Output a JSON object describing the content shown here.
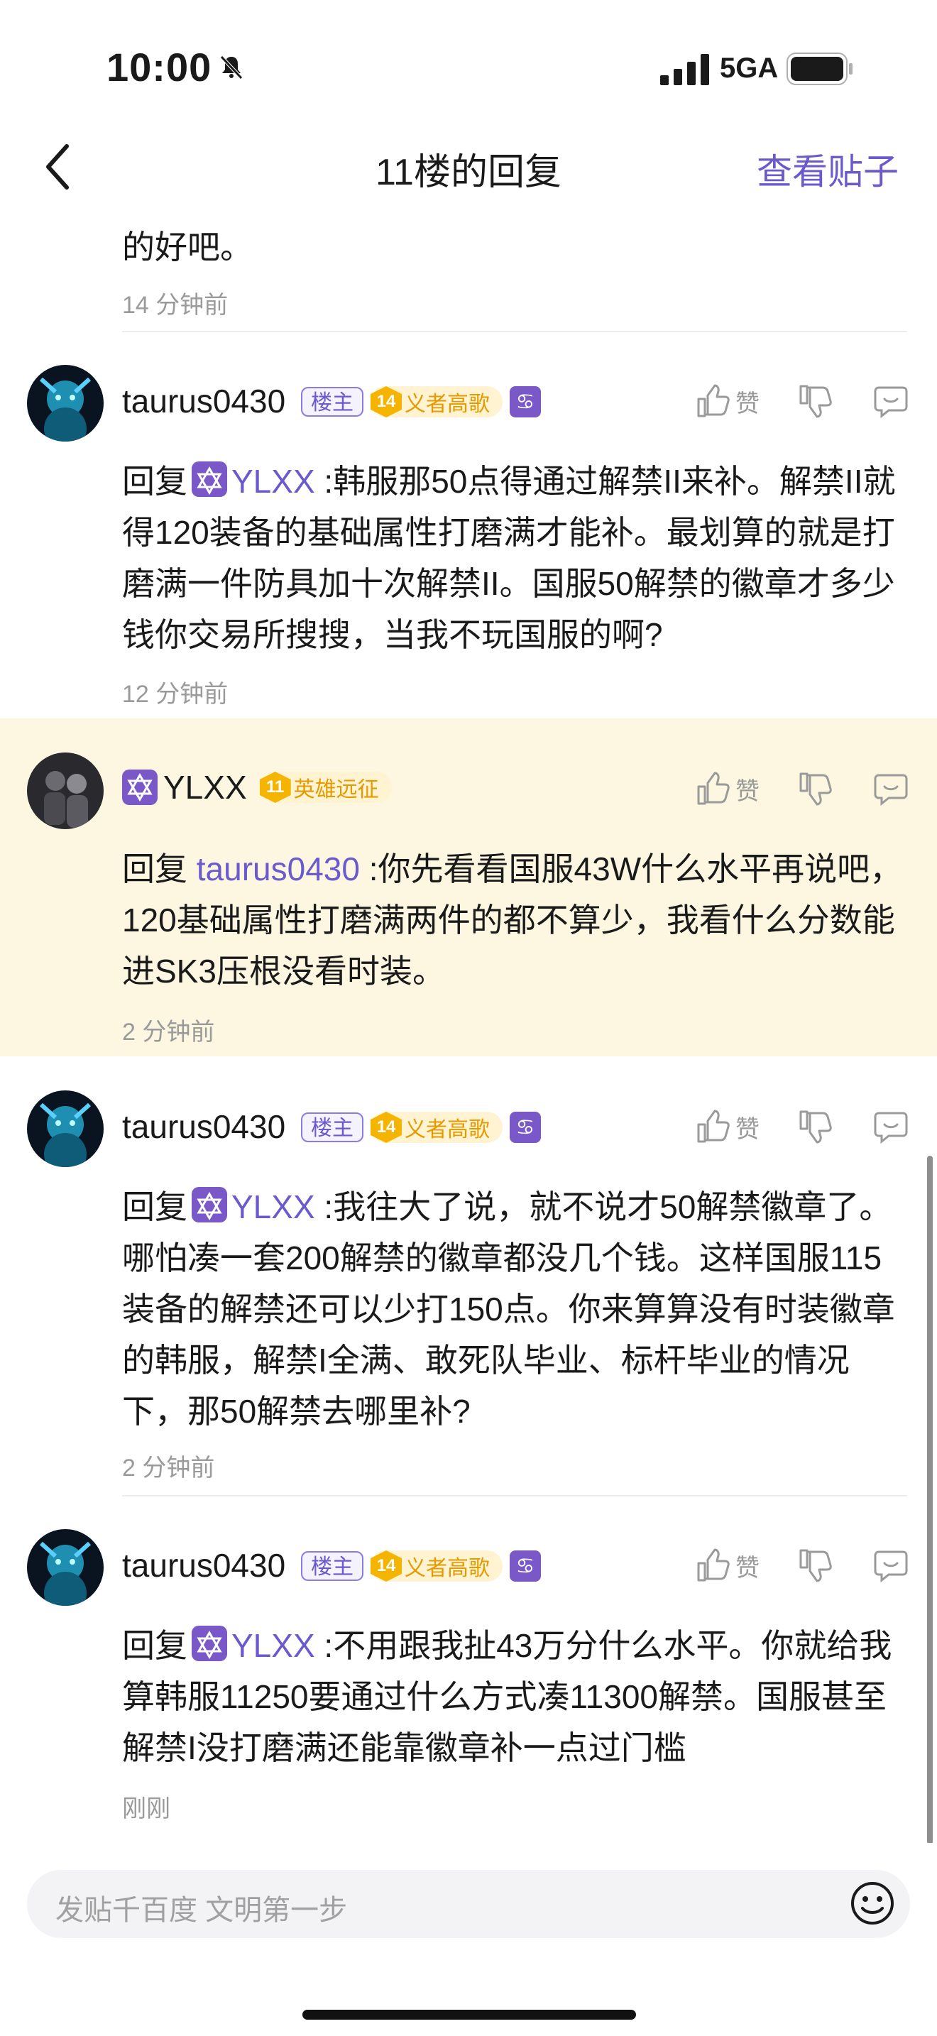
{
  "status": {
    "time": "10:00",
    "network": "5GA"
  },
  "nav": {
    "title": "11楼的回复",
    "action": "查看贴子"
  },
  "prev": {
    "text": "的好吧。",
    "time": "14 分钟前"
  },
  "labels": {
    "reply": "回复",
    "like": "赞",
    "owner_tag": "楼主"
  },
  "colors": {
    "accent": "#6a5acd",
    "highlight_bg": "#fdf7e2",
    "level_gold": "#f5b400"
  },
  "comments": [
    {
      "author": "taurus0430",
      "is_owner": true,
      "level": "14",
      "level_title": "义者高歌",
      "reply_to": "YLXX",
      "text": " :韩服那50点得通过解禁II来补。解禁II就得120装备的基础属性打磨满才能补。最划算的就是打磨满一件防具加十次解禁II。国服50解禁的徽章才多少钱你交易所搜搜，当我不玩国服的啊?",
      "time": "12 分钟前"
    },
    {
      "author": "YLXX",
      "is_owner": false,
      "level": "11",
      "level_title": "英雄远征",
      "reply_to": "taurus0430",
      "text": " :你先看看国服43W什么水平再说吧，120基础属性打磨满两件的都不算少，我看什么分数能进SK3压根没看时装。",
      "time": "2 分钟前"
    },
    {
      "author": "taurus0430",
      "is_owner": true,
      "level": "14",
      "level_title": "义者高歌",
      "reply_to": "YLXX",
      "text": " :我往大了说，就不说才50解禁徽章了。哪怕凑一套200解禁的徽章都没几个钱。这样国服115装备的解禁还可以少打150点。你来算算没有时装徽章的韩服，解禁I全满、敢死队毕业、标杆毕业的情况下，那50解禁去哪里补?",
      "time": "2 分钟前"
    },
    {
      "author": "taurus0430",
      "is_owner": true,
      "level": "14",
      "level_title": "义者高歌",
      "reply_to": "YLXX",
      "text": " :不用跟我扯43万分什么水平。你就给我算韩服11250要通过什么方式凑11300解禁。国服甚至解禁I没打磨满还能靠徽章补一点过门槛",
      "time": "刚刚"
    }
  ],
  "input": {
    "placeholder": "发贴千百度 文明第一步"
  },
  "icons": [
    "bell-off-icon",
    "signal-icon",
    "battery-icon",
    "back-chevron-icon",
    "thumbs-up-icon",
    "thumbs-down-icon",
    "comment-icon",
    "emoji-icon",
    "zodiac-cancer-icon",
    "star-of-david-icon"
  ]
}
